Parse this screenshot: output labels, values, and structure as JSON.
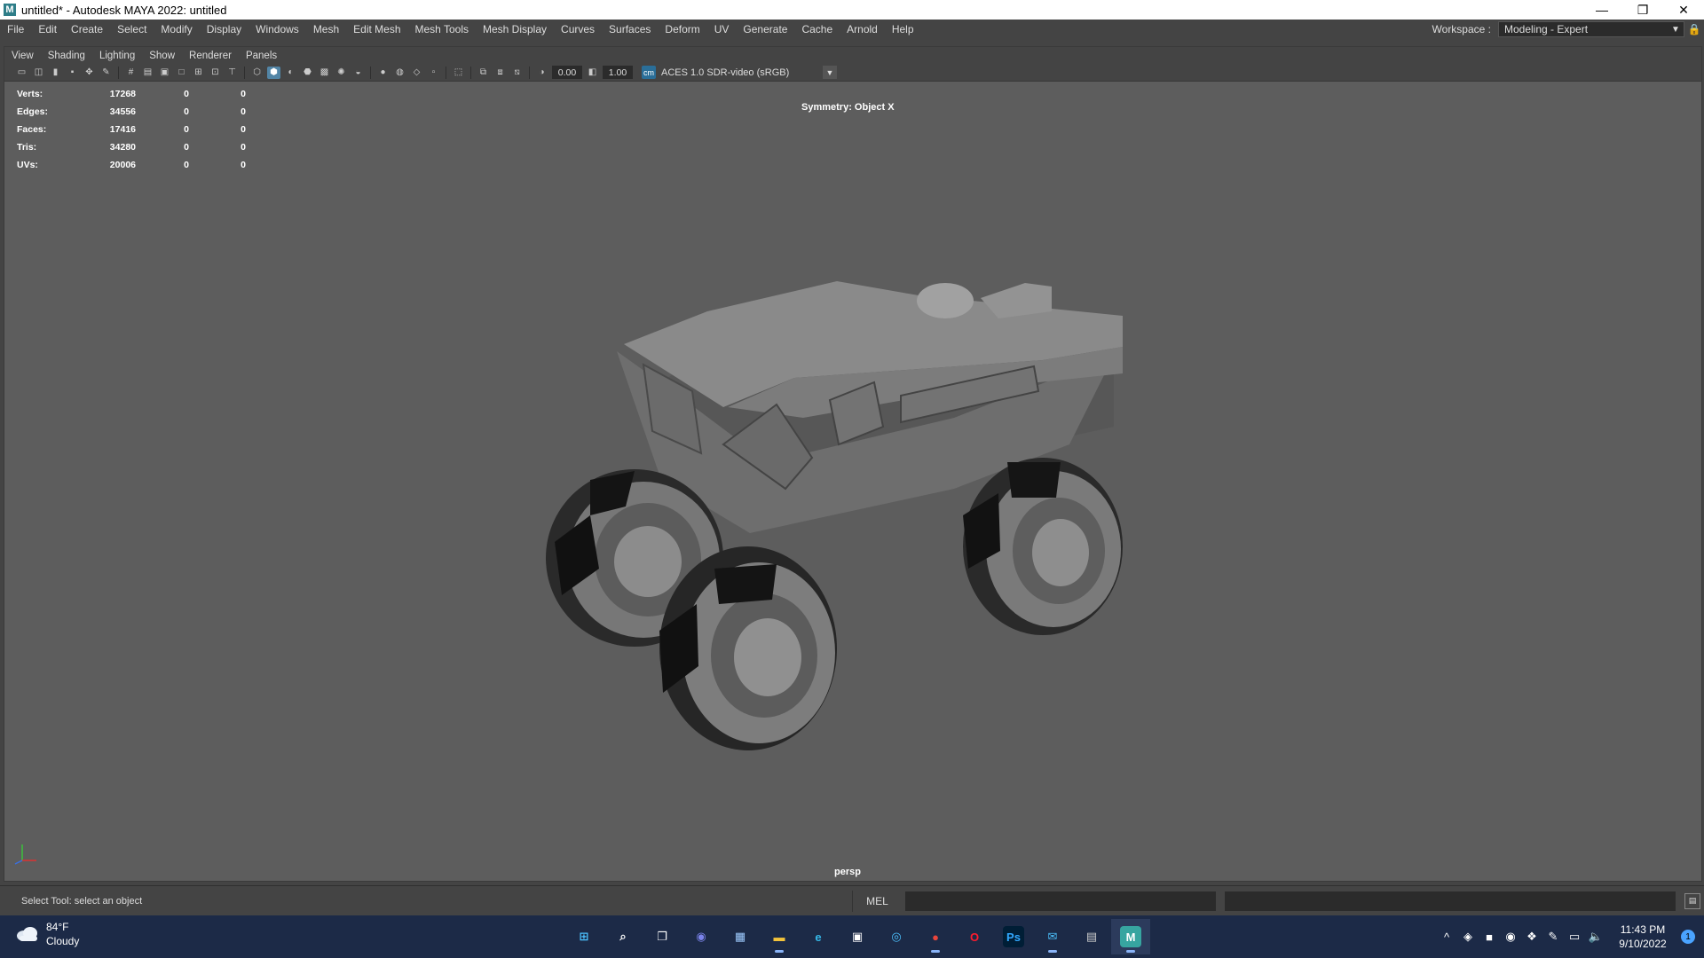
{
  "window": {
    "title": "untitled* - Autodesk MAYA 2022: untitled",
    "app_icon": "M",
    "minimize": "—",
    "restore": "❐",
    "close": "✕"
  },
  "menu": [
    "File",
    "Edit",
    "Create",
    "Select",
    "Modify",
    "Display",
    "Windows",
    "Mesh",
    "Edit Mesh",
    "Mesh Tools",
    "Mesh Display",
    "Curves",
    "Surfaces",
    "Deform",
    "UV",
    "Generate",
    "Cache",
    "Arnold",
    "Help"
  ],
  "workspace": {
    "label": "Workspace :",
    "value": "Modeling - Expert"
  },
  "panel_menu": [
    "View",
    "Shading",
    "Lighting",
    "Show",
    "Renderer",
    "Panels"
  ],
  "toolbar": {
    "exposure": "0.00",
    "gamma": "1.00",
    "colorspace": "ACES 1.0 SDR-video (sRGB)"
  },
  "hud": {
    "rows": [
      {
        "label": "Verts:",
        "v1": "17268",
        "v2": "0",
        "v3": "0"
      },
      {
        "label": "Edges:",
        "v1": "34556",
        "v2": "0",
        "v3": "0"
      },
      {
        "label": "Faces:",
        "v1": "17416",
        "v2": "0",
        "v3": "0"
      },
      {
        "label": "Tris:",
        "v1": "34280",
        "v2": "0",
        "v3": "0"
      },
      {
        "label": "UVs:",
        "v1": "20006",
        "v2": "0",
        "v3": "0"
      }
    ],
    "symmetry": "Symmetry: Object X",
    "camera": "persp"
  },
  "helpline": {
    "help": "Select Tool: select an object",
    "lang": "MEL"
  },
  "taskbar": {
    "weather_temp": "84°F",
    "weather_desc": "Cloudy",
    "time": "11:43 PM",
    "date": "9/10/2022",
    "notifications": "1",
    "apps": [
      {
        "name": "windows-start",
        "label": "⊞",
        "color": "#4cc2ff"
      },
      {
        "name": "search",
        "label": "⌕",
        "color": "#ffffff"
      },
      {
        "name": "task-view",
        "label": "❐",
        "color": "#ffffff"
      },
      {
        "name": "teams-chat",
        "label": "◉",
        "color": "#7b83eb"
      },
      {
        "name": "photos",
        "label": "▦",
        "color": "#9ecbff"
      },
      {
        "name": "file-explorer",
        "label": "▬",
        "color": "#f3c33b"
      },
      {
        "name": "edge",
        "label": "e",
        "color": "#35b8e8"
      },
      {
        "name": "store",
        "label": "▣",
        "color": "#ffffff"
      },
      {
        "name": "settings-app",
        "label": "◎",
        "color": "#4cc2ff"
      },
      {
        "name": "chrome",
        "label": "●",
        "color": "#e8453c"
      },
      {
        "name": "opera",
        "label": "O",
        "color": "#ff1b2d"
      },
      {
        "name": "photoshop",
        "label": "Ps",
        "color": "#31a8ff"
      },
      {
        "name": "mail",
        "label": "✉",
        "color": "#4cc2ff"
      },
      {
        "name": "calculator",
        "label": "▤",
        "color": "#cccccc"
      },
      {
        "name": "maya",
        "label": "M",
        "color": "#37a5a0"
      }
    ]
  }
}
